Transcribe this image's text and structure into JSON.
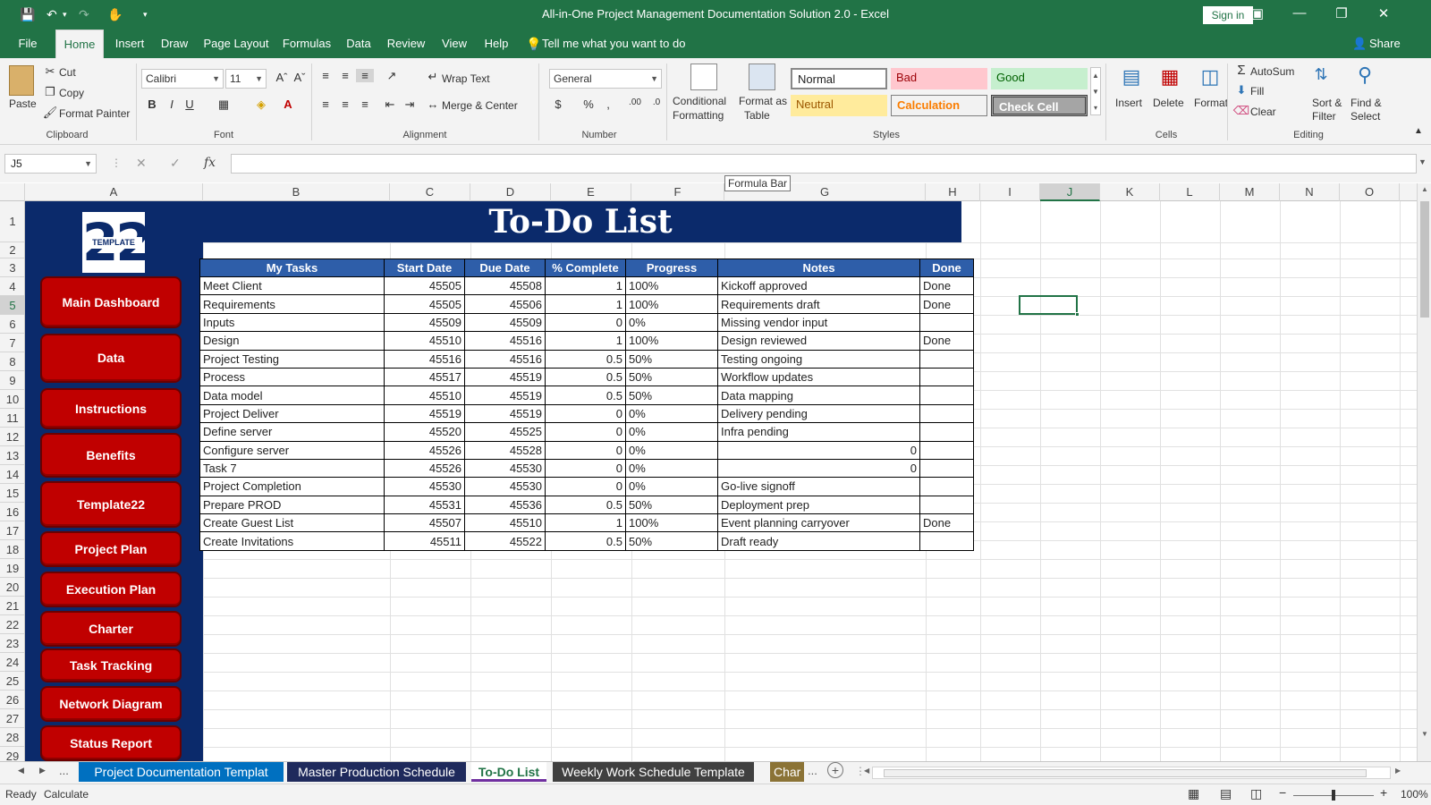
{
  "window": {
    "title": "All-in-One Project Management Documentation Solution 2.0  -  Excel",
    "sign_in": "Sign in"
  },
  "ribbon_tabs": [
    "File",
    "Home",
    "Insert",
    "Draw",
    "Page Layout",
    "Formulas",
    "Data",
    "Review",
    "View",
    "Help"
  ],
  "active_tab": "Home",
  "tell_me": "Tell me what you want to do",
  "share": "Share",
  "clipboard": {
    "paste": "Paste",
    "cut": "Cut",
    "copy": "Copy",
    "format_painter": "Format Painter",
    "group": "Clipboard"
  },
  "font": {
    "name": "Calibri",
    "size": "11",
    "group": "Font"
  },
  "alignment": {
    "wrap": "Wrap Text",
    "merge": "Merge & Center",
    "group": "Alignment"
  },
  "number": {
    "format": "General",
    "group": "Number"
  },
  "styles": {
    "conditional": "Conditional",
    "conditional2": "Formatting",
    "format_table": "Format as",
    "format_table2": "Table",
    "normal": "Normal",
    "bad": "Bad",
    "good": "Good",
    "neutral": "Neutral",
    "calculation": "Calculation",
    "check": "Check Cell",
    "group": "Styles"
  },
  "cells": {
    "insert": "Insert",
    "delete": "Delete",
    "format": "Format",
    "group": "Cells"
  },
  "editing": {
    "autosum": "AutoSum",
    "fill": "Fill",
    "clear": "Clear",
    "sort": "Sort &",
    "sort2": "Filter",
    "find": "Find &",
    "find2": "Select",
    "group": "Editing"
  },
  "formula_bar": {
    "name_box": "J5",
    "tooltip": "Formula Bar",
    "fx": "fx"
  },
  "columns": [
    "A",
    "B",
    "C",
    "D",
    "E",
    "F",
    "G",
    "H",
    "I",
    "J",
    "K",
    "L",
    "M",
    "N",
    "O"
  ],
  "rows": [
    "1",
    "2",
    "3",
    "4",
    "5",
    "6",
    "7",
    "8",
    "9",
    "10",
    "11",
    "12",
    "13",
    "14",
    "15",
    "16",
    "17",
    "18",
    "19",
    "20",
    "21",
    "22",
    "23",
    "24",
    "25",
    "26",
    "27",
    "28",
    "29"
  ],
  "logo": {
    "number": "22",
    "text": "TEMPLATE"
  },
  "nav_buttons": [
    "Main Dashboard",
    "Data",
    "Instructions",
    "Benefits",
    "Template22",
    "Project Plan",
    "Execution Plan",
    "Charter",
    "Task Tracking",
    "Network Diagram",
    "Status Report"
  ],
  "sheet_title": "To-Do List",
  "table": {
    "headers": [
      "My Tasks",
      "Start Date",
      "Due Date",
      "% Complete",
      "Progress",
      "Notes",
      "Done"
    ],
    "rows": [
      [
        "Meet Client",
        "45505",
        "45508",
        "1",
        "100%",
        "Kickoff approved",
        "Done"
      ],
      [
        "Requirements",
        "45505",
        "45506",
        "1",
        "100%",
        "Requirements draft",
        "Done"
      ],
      [
        "Inputs",
        "45509",
        "45509",
        "0",
        "0%",
        "Missing vendor input",
        ""
      ],
      [
        "Design",
        "45510",
        "45516",
        "1",
        "100%",
        "Design reviewed",
        "Done"
      ],
      [
        "Project Testing",
        "45516",
        "45516",
        "0.5",
        "50%",
        "Testing ongoing",
        ""
      ],
      [
        "Process",
        "45517",
        "45519",
        "0.5",
        "50%",
        "Workflow updates",
        ""
      ],
      [
        "Data model",
        "45510",
        "45519",
        "0.5",
        "50%",
        "Data mapping",
        ""
      ],
      [
        "Project Deliver",
        "45519",
        "45519",
        "0",
        "0%",
        "Delivery pending",
        ""
      ],
      [
        "Define server",
        "45520",
        "45525",
        "0",
        "0%",
        "Infra pending",
        ""
      ],
      [
        "Configure server",
        "45526",
        "45528",
        "0",
        "0%",
        "0",
        ""
      ],
      [
        "Task 7",
        "45526",
        "45530",
        "0",
        "0%",
        "0",
        ""
      ],
      [
        "Project Completion",
        "45530",
        "45530",
        "0",
        "0%",
        "Go-live signoff",
        ""
      ],
      [
        "Prepare PROD",
        "45531",
        "45536",
        "0.5",
        "50%",
        "Deployment prep",
        ""
      ],
      [
        "Create Guest List",
        "45507",
        "45510",
        "1",
        "100%",
        "Event planning carryover",
        "Done"
      ],
      [
        "Create Invitations",
        "45511",
        "45522",
        "0.5",
        "50%",
        "Draft ready",
        ""
      ]
    ]
  },
  "sheet_tabs": [
    "Project Documentation Templat",
    "Master Production Schedule",
    "To-Do List",
    "Weekly Work Schedule Template",
    "Char"
  ],
  "sheet_ellipsis_left": "...",
  "sheet_ellipsis_right": "...",
  "status": {
    "ready": "Ready",
    "calculate": "Calculate",
    "zoom": "100%"
  }
}
